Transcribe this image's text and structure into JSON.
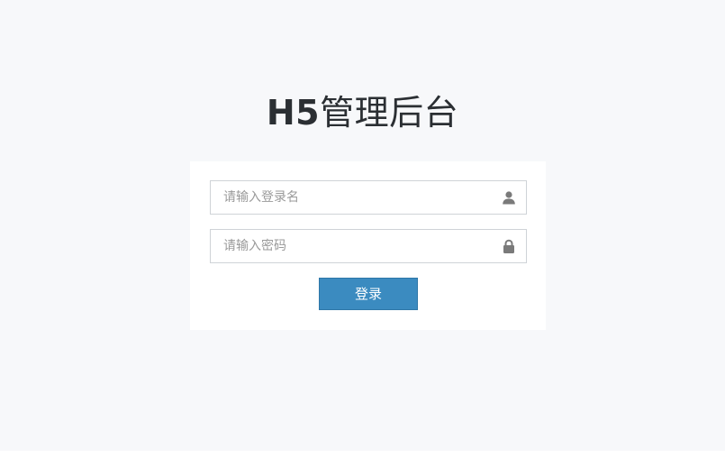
{
  "title": {
    "brand": "H5",
    "suffix": "管理后台"
  },
  "login_form": {
    "username_placeholder": "请输入登录名",
    "username_icon": "user-icon",
    "password_placeholder": "请输入密码",
    "password_icon": "lock-icon",
    "submit_label": "登录"
  },
  "colors": {
    "background": "#f7f8fa",
    "card": "#ffffff",
    "button": "#3b8bc0",
    "title_text": "#2b2f33",
    "icon": "#7a7a7a"
  }
}
